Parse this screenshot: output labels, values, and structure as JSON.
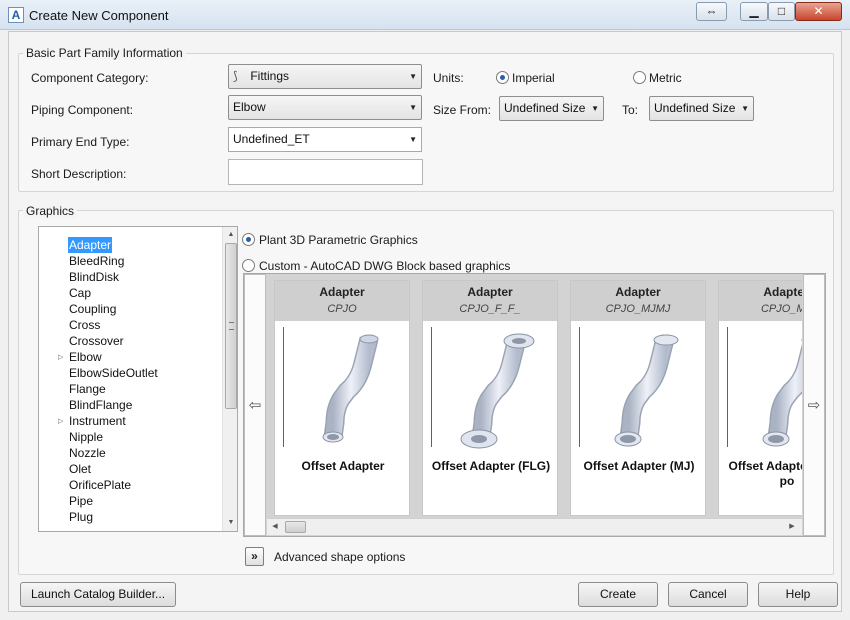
{
  "window": {
    "title": "Create New Component",
    "app_icon_letter": "A"
  },
  "basic": {
    "legend": "Basic Part Family Information",
    "component_category_label": "Component Category:",
    "component_category_value": "Fittings",
    "piping_component_label": "Piping Component:",
    "piping_component_value": "Elbow",
    "primary_end_type_label": "Primary End Type:",
    "primary_end_type_value": "Undefined_ET",
    "short_description_label": "Short Description:",
    "short_description_value": "",
    "units_label": "Units:",
    "units_imperial": "Imperial",
    "units_metric": "Metric",
    "units_selected": "Imperial",
    "size_from_label": "Size From:",
    "size_from_value": "Undefined Size",
    "to_label": "To:",
    "to_value": "Undefined Size"
  },
  "graphics": {
    "legend": "Graphics",
    "tree_items": [
      {
        "label": "Adapter",
        "selected": true,
        "expandable": false
      },
      {
        "label": "BleedRing",
        "selected": false,
        "expandable": false
      },
      {
        "label": "BlindDisk",
        "selected": false,
        "expandable": false
      },
      {
        "label": "Cap",
        "selected": false,
        "expandable": false
      },
      {
        "label": "Coupling",
        "selected": false,
        "expandable": false
      },
      {
        "label": "Cross",
        "selected": false,
        "expandable": false
      },
      {
        "label": "Crossover",
        "selected": false,
        "expandable": false
      },
      {
        "label": "Elbow",
        "selected": false,
        "expandable": true
      },
      {
        "label": "ElbowSideOutlet",
        "selected": false,
        "expandable": false
      },
      {
        "label": "Flange",
        "selected": false,
        "expandable": false
      },
      {
        "label": "BlindFlange",
        "selected": false,
        "expandable": false
      },
      {
        "label": "Instrument",
        "selected": false,
        "expandable": true
      },
      {
        "label": "Nipple",
        "selected": false,
        "expandable": false
      },
      {
        "label": "Nozzle",
        "selected": false,
        "expandable": false
      },
      {
        "label": "Olet",
        "selected": false,
        "expandable": false
      },
      {
        "label": "OrificePlate",
        "selected": false,
        "expandable": false
      },
      {
        "label": "Pipe",
        "selected": false,
        "expandable": false
      },
      {
        "label": "Plug",
        "selected": false,
        "expandable": false
      }
    ],
    "option_parametric": "Plant 3D Parametric Graphics",
    "option_custom": "Custom - AutoCAD DWG Block based graphics",
    "selected_option": "parametric",
    "cards": [
      {
        "title": "Adapter",
        "code": "CPJO",
        "name": "Offset Adapter",
        "variant": "plain"
      },
      {
        "title": "Adapter",
        "code": "CPJO_F_F_",
        "name": "Offset Adapter (FLG)",
        "variant": "flanged"
      },
      {
        "title": "Adapter",
        "code": "CPJO_MJMJ",
        "name": "Offset Adapter (MJ)",
        "variant": "mj"
      },
      {
        "title": "Adapter",
        "code": "CPJO_MJ",
        "name": "Offset Adapter MJ at po",
        "variant": "mjpo"
      }
    ],
    "advanced_label": "Advanced shape options",
    "advanced_icon": "double-chevron-right-icon"
  },
  "footer": {
    "launch_label": "Launch Catalog Builder...",
    "create_label": "Create",
    "cancel_label": "Cancel",
    "help_label": "Help"
  },
  "colors": {
    "selection": "#3399ff",
    "pipe": "#cfd6e4",
    "close": "#c8452d"
  }
}
